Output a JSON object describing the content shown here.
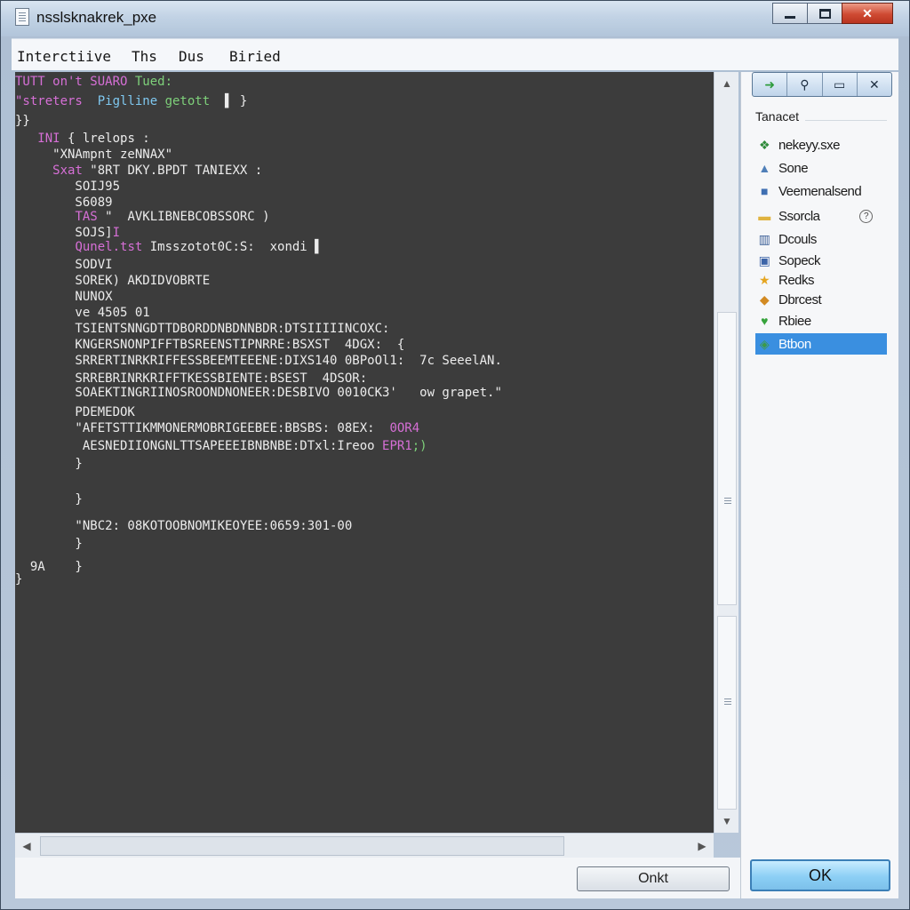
{
  "window": {
    "title": "nsslsknakrek_pxe"
  },
  "menubar": {
    "items": [
      "Interctiive",
      "Ths",
      "Dus",
      "Biried"
    ]
  },
  "editor": {
    "lines": [
      {
        "segments": [
          {
            "t": "TUTT on't SUARO ",
            "c": "purple"
          },
          {
            "t": "Tued:",
            "c": "green"
          }
        ]
      },
      {
        "segments": [
          {
            "t": "\"streters  ",
            "c": "purple"
          },
          {
            "t": "Piglline ",
            "c": "cyan"
          },
          {
            "t": "getott",
            "c": "green"
          },
          {
            "t": "  ▌ }",
            "c": ""
          }
        ]
      },
      {
        "segments": [
          {
            "t": "}}",
            "c": ""
          }
        ]
      },
      {
        "segments": [
          {
            "t": "   ",
            "c": ""
          },
          {
            "t": "INI",
            "c": "purple"
          },
          {
            "t": " { lrelops :",
            "c": ""
          }
        ]
      },
      {
        "segments": [
          {
            "t": "     \"XNAmpnt zeNNAX\"",
            "c": ""
          }
        ]
      },
      {
        "segments": [
          {
            "t": "     ",
            "c": ""
          },
          {
            "t": "Sxat",
            "c": "purple"
          },
          {
            "t": " \"8RT DKY.BPDT TANIEXX :",
            "c": ""
          }
        ]
      },
      {
        "segments": [
          {
            "t": "        SOIJ95",
            "c": ""
          }
        ]
      },
      {
        "segments": [
          {
            "t": "        S6089",
            "c": ""
          }
        ]
      },
      {
        "segments": [
          {
            "t": "        ",
            "c": ""
          },
          {
            "t": "TAS",
            "c": "purple"
          },
          {
            "t": " \"  AVKLIBNEBCOBSSORC )",
            "c": ""
          }
        ]
      },
      {
        "segments": [
          {
            "t": "        SOJS]",
            "c": ""
          },
          {
            "t": "I",
            "c": "purple"
          }
        ]
      },
      {
        "segments": [
          {
            "t": "        ",
            "c": ""
          },
          {
            "t": "Qunel.tst",
            "c": "purple"
          },
          {
            "t": " Imsszotot0C:S:  xondi ▌",
            "c": ""
          }
        ]
      },
      {
        "segments": [
          {
            "t": "        SODVI",
            "c": ""
          }
        ]
      },
      {
        "segments": [
          {
            "t": "        SOREK) AKDIDVOBRTE",
            "c": ""
          }
        ]
      },
      {
        "segments": [
          {
            "t": "        NUNOX",
            "c": ""
          }
        ]
      },
      {
        "segments": [
          {
            "t": "        ve 4505 01",
            "c": ""
          }
        ]
      },
      {
        "segments": [
          {
            "t": "        TSIENTSNNGDTTDBORDDNBDNNBDR:DTSIIIIINCOXC:",
            "c": ""
          }
        ]
      },
      {
        "segments": [
          {
            "t": "        KNGERSNONPIFFTBSREENSTIPNRRE:BSXST  4DGX:  {",
            "c": ""
          }
        ]
      },
      {
        "segments": [
          {
            "t": "        SRRERTINRKRIFFESSBEEMTEEENE:DIXS140 0BPoOl1:  7c SeeelAN.",
            "c": ""
          }
        ]
      },
      {
        "segments": [
          {
            "t": "        SRREBRINRKRIFFTKESSBIENTE:BSEST  4DSOR:",
            "c": ""
          }
        ]
      },
      {
        "segments": [
          {
            "t": "        SOAEKTINGRIINOSROONDNONEER:DESBIVO 0010CK3'   ow grapet.\"",
            "c": ""
          }
        ]
      },
      {
        "segments": [
          {
            "t": "        PDEMEDOK",
            "c": ""
          }
        ]
      },
      {
        "segments": [
          {
            "t": "        \"AFETSTTIKMMONERMOBRIGEEBEE:BBSBS: 08EX:  ",
            "c": ""
          },
          {
            "t": "0OR4",
            "c": "purple"
          }
        ]
      },
      {
        "segments": [
          {
            "t": "         AESNEDIIONGNLTTSAPEEEIBNBNBE:DTxl:Ireoo ",
            "c": ""
          },
          {
            "t": "EPR1",
            "c": "purple"
          },
          {
            "t": ";)",
            "c": "green"
          }
        ]
      },
      {
        "segments": [
          {
            "t": "        }",
            "c": ""
          }
        ]
      },
      {
        "segments": [
          {
            "t": "        }",
            "c": ""
          }
        ]
      },
      {
        "segments": [
          {
            "t": "        \"NBC2: 08KOTOOBNOMIKEOYEE:0659:301-00",
            "c": ""
          }
        ]
      },
      {
        "segments": [
          {
            "t": "        }",
            "c": ""
          }
        ]
      },
      {
        "segments": [
          {
            "t": "  9A    }",
            "c": ""
          }
        ]
      },
      {
        "segments": [
          {
            "t": "}",
            "c": ""
          }
        ]
      }
    ]
  },
  "sidepanel": {
    "heading": "Tanacet",
    "items": [
      {
        "label": "nekeyy.sxe",
        "icon": "network-icon",
        "glyph": "❖",
        "color": "#2f8a3a"
      },
      {
        "label": "Sone",
        "icon": "triangle-icon",
        "glyph": "▲",
        "color": "#4f7fb8"
      },
      {
        "label": "Veemenalsend",
        "icon": "square-icon",
        "glyph": "■",
        "color": "#3f6fb2"
      },
      {
        "label": "Ssorcla",
        "icon": "folder-icon",
        "glyph": "▬",
        "color": "#e0b340",
        "help": "?"
      },
      {
        "label": "Dcouls",
        "icon": "document-icon",
        "glyph": "▥",
        "color": "#3c5f97"
      },
      {
        "label": "Sopeck",
        "icon": "monitor-icon",
        "glyph": "▣",
        "color": "#3c64a8"
      },
      {
        "label": "Redks",
        "icon": "star-icon",
        "glyph": "★",
        "color": "#e5a520"
      },
      {
        "label": "Dbrcest",
        "icon": "package-icon",
        "glyph": "◆",
        "color": "#d28a22"
      },
      {
        "label": "Rbiee",
        "icon": "heart-icon",
        "glyph": "♥",
        "color": "#37a33c"
      },
      {
        "label": "Btbon",
        "icon": "gem-icon",
        "glyph": "◈",
        "color": "#3c9a48",
        "selected": true
      }
    ]
  },
  "buttons": {
    "secondary": "Onkt",
    "primary": "OK"
  },
  "colors": {
    "editor_bg": "#3c3c3c",
    "keyword": "#d66fd6",
    "string": "#7ed07a",
    "identifier": "#7fc8f0",
    "selection": "#3a8fe0"
  }
}
